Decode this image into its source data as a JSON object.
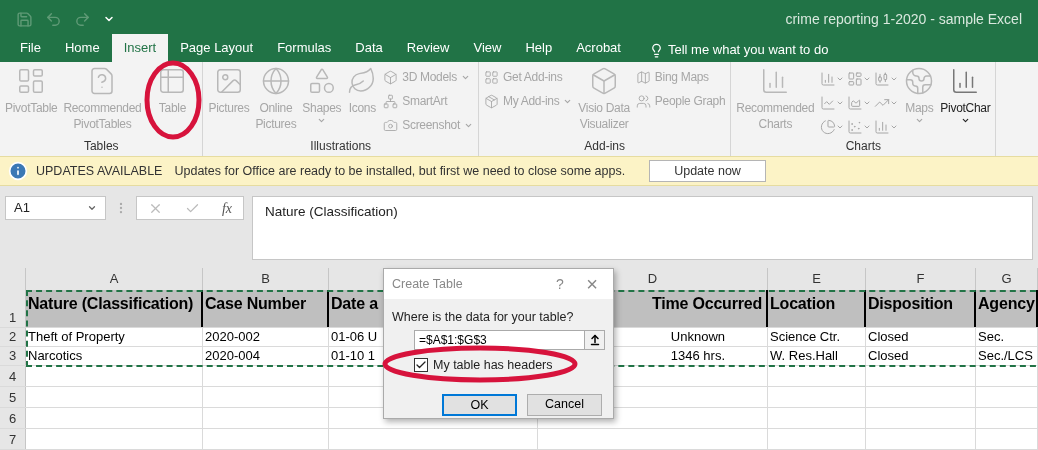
{
  "window": {
    "title": "crime reporting 1-2020 - sample Excel"
  },
  "tabs": [
    {
      "label": "File",
      "selected": false
    },
    {
      "label": "Home",
      "selected": false
    },
    {
      "label": "Insert",
      "selected": true
    },
    {
      "label": "Page Layout",
      "selected": false
    },
    {
      "label": "Formulas",
      "selected": false
    },
    {
      "label": "Data",
      "selected": false
    },
    {
      "label": "Review",
      "selected": false
    },
    {
      "label": "View",
      "selected": false
    },
    {
      "label": "Help",
      "selected": false
    },
    {
      "label": "Acrobat",
      "selected": false
    }
  ],
  "tell_me": {
    "placeholder": "Tell me what you want to do"
  },
  "ribbon": [
    {
      "label": "Tables",
      "items": [
        {
          "kind": "large",
          "label": "PivotTable",
          "disabled": true,
          "dropdown": false
        },
        {
          "kind": "large",
          "label": "Recommended\nPivotTables",
          "disabled": true,
          "dropdown": false
        },
        {
          "kind": "large",
          "label": "Table",
          "disabled": true,
          "dropdown": false
        }
      ]
    },
    {
      "label": "Illustrations",
      "items": [
        {
          "kind": "large",
          "label": "Pictures",
          "disabled": true,
          "dropdown": false
        },
        {
          "kind": "large",
          "label": "Online\nPictures",
          "disabled": true,
          "dropdown": false
        },
        {
          "kind": "large",
          "label": "Shapes",
          "disabled": true,
          "dropdown": true
        },
        {
          "kind": "large",
          "label": "Icons",
          "disabled": true,
          "dropdown": false
        },
        {
          "kind": "small",
          "entries": [
            {
              "label": "3D Models",
              "disabled": true,
              "dropdown": true
            },
            {
              "label": "SmartArt",
              "disabled": true,
              "dropdown": false
            },
            {
              "label": "Screenshot",
              "disabled": true,
              "dropdown": true
            }
          ]
        }
      ]
    },
    {
      "label": "Add-ins",
      "items": [
        {
          "kind": "small",
          "entries": [
            {
              "label": "Get Add-ins",
              "disabled": true,
              "dropdown": false
            },
            {
              "label": "My Add-ins",
              "disabled": true,
              "dropdown": true
            }
          ]
        },
        {
          "kind": "large",
          "label": "Visio Data\nVisualizer",
          "disabled": true,
          "dropdown": false
        },
        {
          "kind": "small",
          "entries": [
            {
              "label": "Bing Maps",
              "disabled": true,
              "dropdown": false
            },
            {
              "label": "People Graph",
              "disabled": true,
              "dropdown": false
            }
          ]
        }
      ]
    },
    {
      "label": "Charts",
      "items": [
        {
          "kind": "large",
          "label": "Recommended\nCharts",
          "disabled": true,
          "dropdown": false
        },
        {
          "kind": "chart-grid",
          "disabled": true
        },
        {
          "kind": "large",
          "label": "Maps",
          "disabled": true,
          "dropdown": true
        },
        {
          "kind": "large",
          "label": "PivotChar",
          "disabled": false,
          "dropdown": true
        }
      ]
    }
  ],
  "notice": {
    "heading": "UPDATES AVAILABLE",
    "message": "Updates for Office are ready to be installed, but first we need to close some apps.",
    "button": "Update now"
  },
  "formula_bar": {
    "name_box": "A1",
    "fx": "fx",
    "value": "Nature (Classification)"
  },
  "sheet": {
    "columns": [
      "A",
      "B",
      "",
      "D",
      "E",
      "F",
      "G"
    ],
    "rows": [
      {
        "number": "1",
        "cells": [
          "Nature (Classification)",
          "Case Number",
          "Date a",
          "Time Occurred",
          "Location",
          "Disposition",
          "Agency"
        ]
      },
      {
        "number": "2",
        "cells": [
          "Theft of Property",
          "2020-002",
          "01-06 U",
          "Unknown",
          "Science Ctr.",
          "Closed",
          "Sec."
        ]
      },
      {
        "number": "3",
        "cells": [
          "Narcotics",
          "2020-004",
          "01-10 1",
          "1346 hrs.",
          "W. Res.Hall",
          "Closed",
          "Sec./LCS"
        ]
      },
      {
        "number": "4",
        "cells": []
      },
      {
        "number": "5",
        "cells": []
      },
      {
        "number": "6",
        "cells": []
      },
      {
        "number": "7",
        "cells": []
      }
    ]
  },
  "dialog": {
    "title": "Create Table",
    "help": "?",
    "close": "×",
    "prompt": "Where is the data for your table?",
    "range": "=$A$1:$G$3",
    "headers_label": "My table has headers",
    "headers_checked": true,
    "ok": "OK",
    "cancel": "Cancel"
  }
}
